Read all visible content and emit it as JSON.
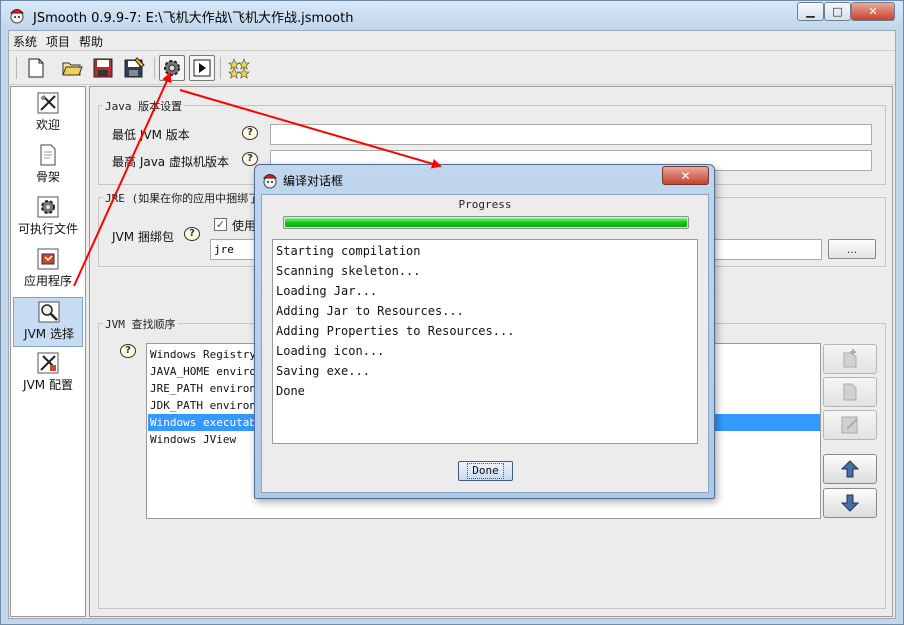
{
  "window": {
    "title": "JSmooth 0.9.9-7: E:\\飞机大作战\\飞机大作战.jsmooth",
    "minimize_glyph": "▁",
    "maximize_glyph": "□",
    "close_glyph": "✕"
  },
  "menu": [
    "系统",
    "项目",
    "帮助"
  ],
  "toolbar": {
    "icons": [
      "new-file-icon",
      "open-folder-icon",
      "save-icon",
      "save-as-icon",
      "compile-gear-icon",
      "run-icon",
      "stars-icon"
    ]
  },
  "sidebar": {
    "items": [
      {
        "label": "欢迎",
        "icon": "welcome-icon"
      },
      {
        "label": "骨架",
        "icon": "skeleton-icon"
      },
      {
        "label": "可执行文件",
        "icon": "executable-icon"
      },
      {
        "label": "应用程序",
        "icon": "application-icon"
      },
      {
        "label": "JVM 选择",
        "icon": "jvm-selection-icon",
        "selected": true
      },
      {
        "label": "JVM 配置",
        "icon": "jvm-config-icon"
      }
    ]
  },
  "java_version": {
    "group_title": "Java 版本设置",
    "min_label": "最低 JVM 版本",
    "max_label": "最高 Java 虚拟机版本",
    "min_value": "",
    "max_value": ""
  },
  "jre_bundle": {
    "group_title": "JRE (如果在你的应用中捆绑了",
    "label": "JVM 捆绑包",
    "checkbox_label": "使用",
    "checkbox_checked": true,
    "path_value": "jre",
    "browse_label": "..."
  },
  "jvm_search": {
    "group_title": "JVM 查找顺序",
    "items": [
      "Windows Registry",
      "JAVA_HOME environment variable",
      "JRE_PATH environment variable",
      "JDK_PATH environment variable",
      "Windows executable",
      "Windows JView"
    ],
    "selected_index": 4
  },
  "dialog": {
    "title": "编译对话框",
    "close_glyph": "✕",
    "progress_label": "Progress",
    "progress": 1.0,
    "log": [
      "Starting compilation",
      "Scanning skeleton...",
      "Loading Jar...",
      "Adding Jar to Resources...",
      "Adding Properties to Resources...",
      "Loading icon...",
      "Saving exe...",
      "Done"
    ],
    "done_label": "Done"
  },
  "colors": {
    "selection": "#3399ff",
    "progress": "#17c417",
    "annotation_arrow": "#ff0000"
  }
}
